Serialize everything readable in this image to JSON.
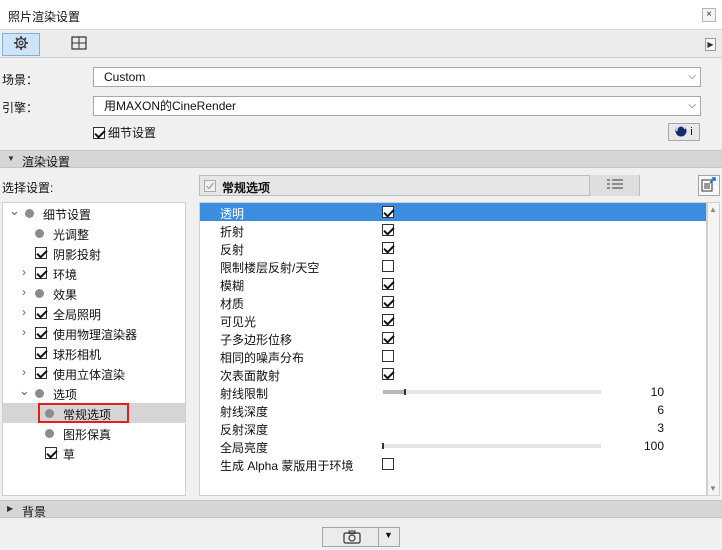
{
  "window": {
    "title": "照片渲染设置",
    "close_label": "×"
  },
  "tabs": [
    {
      "name": "gear-icon",
      "active": true
    },
    {
      "name": "layout-grid-icon",
      "active": false
    }
  ],
  "tab_arrow": "▶",
  "scene": {
    "label": "场景：",
    "value": "Custom"
  },
  "engine": {
    "label": "引擎：",
    "value": "用MAXON的CineRender"
  },
  "detail_settings": {
    "label": "细节设置",
    "checked": true
  },
  "info_button": {
    "label": "i"
  },
  "render_settings_section": {
    "label": "渲染设置"
  },
  "select_settings": {
    "label": "选择设置:"
  },
  "current_panel": {
    "label": "常规选项"
  },
  "tree": [
    {
      "label": "细节设置",
      "type": "dot",
      "expand": "down",
      "level": 0,
      "selected": false
    },
    {
      "label": "光调整",
      "type": "dot",
      "expand": "",
      "level": 1,
      "selected": false
    },
    {
      "label": "阴影投射",
      "type": "check",
      "checked": true,
      "expand": "",
      "level": 1,
      "selected": false
    },
    {
      "label": "环境",
      "type": "check",
      "checked": true,
      "expand": "right",
      "level": 1,
      "selected": false
    },
    {
      "label": "效果",
      "type": "dot",
      "expand": "right",
      "level": 1,
      "selected": false
    },
    {
      "label": "全局照明",
      "type": "check",
      "checked": true,
      "expand": "right",
      "level": 1,
      "selected": false
    },
    {
      "label": "使用物理渲染器",
      "type": "check",
      "checked": true,
      "expand": "right",
      "level": 1,
      "selected": false
    },
    {
      "label": "球形相机",
      "type": "check",
      "checked": true,
      "expand": "",
      "level": 1,
      "selected": false
    },
    {
      "label": "使用立体渲染",
      "type": "check",
      "checked": true,
      "expand": "right",
      "level": 1,
      "selected": false
    },
    {
      "label": "选项",
      "type": "dot",
      "expand": "down",
      "level": 1,
      "selected": false
    },
    {
      "label": "常规选项",
      "type": "dot",
      "expand": "",
      "level": 2,
      "selected": true
    },
    {
      "label": "图形保真",
      "type": "dot",
      "expand": "",
      "level": 2,
      "selected": false
    },
    {
      "label": "草",
      "type": "check",
      "checked": true,
      "expand": "",
      "level": 2,
      "selected": false
    }
  ],
  "properties": [
    {
      "label": "透明",
      "type": "check",
      "checked": true,
      "selected": true
    },
    {
      "label": "折射",
      "type": "check",
      "checked": true
    },
    {
      "label": "反射",
      "type": "check",
      "checked": true
    },
    {
      "label": "限制楼层反射/天空",
      "type": "check",
      "checked": false
    },
    {
      "label": "模糊",
      "type": "check",
      "checked": true
    },
    {
      "label": "材质",
      "type": "check",
      "checked": true
    },
    {
      "label": "可见光",
      "type": "check",
      "checked": true
    },
    {
      "label": "子多边形位移",
      "type": "check",
      "checked": true
    },
    {
      "label": "相同的噪声分布",
      "type": "check",
      "checked": false
    },
    {
      "label": "次表面散射",
      "type": "check",
      "checked": true
    },
    {
      "label": "射线限制",
      "type": "slider",
      "value": "10",
      "fraction": 0.1
    },
    {
      "label": "射线深度",
      "type": "value",
      "value": "6"
    },
    {
      "label": "反射深度",
      "type": "value",
      "value": "3"
    },
    {
      "label": "全局亮度",
      "type": "slider",
      "value": "100",
      "fraction": 0.0
    },
    {
      "label": "生成 Alpha 蒙版用于环境",
      "type": "check",
      "checked": false
    }
  ],
  "background_section": {
    "label": "背景"
  }
}
